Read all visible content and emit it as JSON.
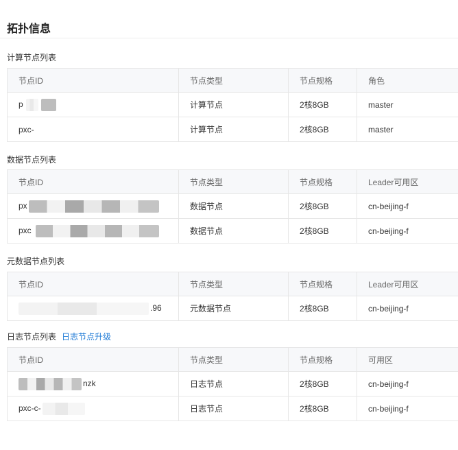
{
  "page": {
    "title": "拓扑信息"
  },
  "sections": [
    {
      "title": "计算节点列表",
      "headers": [
        "节点ID",
        "节点类型",
        "节点规格",
        "角色"
      ],
      "rows": [
        {
          "node_id": "p",
          "type": "计算节点",
          "spec": "2核8GB",
          "last": "master"
        },
        {
          "node_id": "pxc-",
          "type": "计算节点",
          "spec": "2核8GB",
          "last": "master"
        }
      ]
    },
    {
      "title": "数据节点列表",
      "headers": [
        "节点ID",
        "节点类型",
        "节点规格",
        "Leader可用区"
      ],
      "rows": [
        {
          "node_id": "px",
          "type": "数据节点",
          "spec": "2核8GB",
          "last": "cn-beijing-f"
        },
        {
          "node_id": "pxc",
          "type": "数据节点",
          "spec": "2核8GB",
          "last": "cn-beijing-f"
        }
      ]
    },
    {
      "title": "元数据节点列表",
      "headers": [
        "节点ID",
        "节点类型",
        "节点规格",
        "Leader可用区"
      ],
      "rows": [
        {
          "node_id": ".96",
          "type": "元数据节点",
          "spec": "2核8GB",
          "last": "cn-beijing-f"
        }
      ]
    },
    {
      "title": "日志节点列表",
      "link": "日志节点升级",
      "headers": [
        "节点ID",
        "节点类型",
        "节点规格",
        "可用区"
      ],
      "rows": [
        {
          "node_id": "nzk",
          "type": "日志节点",
          "spec": "2核8GB",
          "last": "cn-beijing-f"
        },
        {
          "node_id": "pxc-c-",
          "type": "日志节点",
          "spec": "2核8GB",
          "last": "cn-beijing-f"
        }
      ]
    }
  ]
}
